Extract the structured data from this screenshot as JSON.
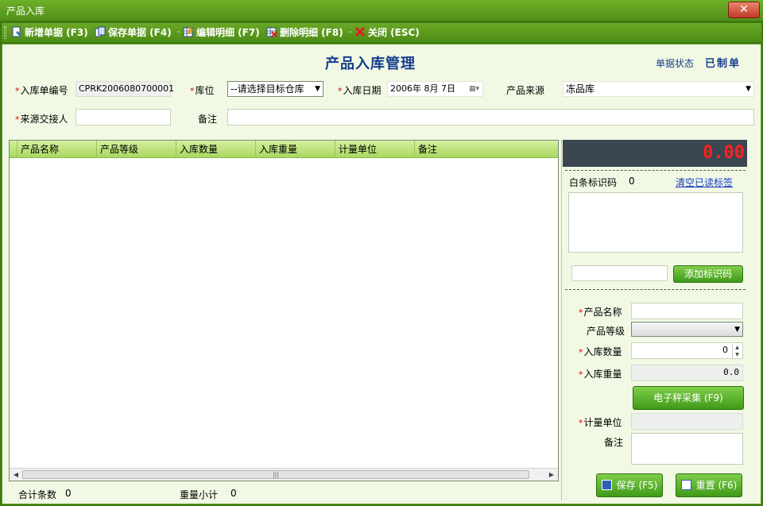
{
  "window": {
    "title": "产品入库",
    "close_label": "✕"
  },
  "toolbar": {
    "new_label": "新增单据 (F3)",
    "save_label": "保存单据 (F4)",
    "edit_label": "编辑明细 (F7)",
    "delete_label": "删除明细 (F8)",
    "close_label": "关闭 (ESC)",
    "separator": "-"
  },
  "header": {
    "title": "产品入库管理",
    "status_label": "单据状态",
    "status_value": "已制单"
  },
  "form": {
    "req_mark": "*",
    "order_no_label": "入库单编号",
    "order_no_value": "CPRK2006080700001",
    "location_label": "库位",
    "location_value": "--请选择目标仓库",
    "date_label": "入库日期",
    "date_value": "2006年 8月 7日",
    "source_label": "产品来源",
    "source_value": "冻品库",
    "handover_label": "来源交接人",
    "handover_value": "",
    "remark_label": "备注",
    "remark_value": ""
  },
  "grid": {
    "columns": [
      "产品名称",
      "产品等级",
      "入库数量",
      "入库重量",
      "计量单位",
      "备注"
    ],
    "rows": [],
    "scroll_grip": "|||"
  },
  "footer": {
    "total_count_label": "合计条数",
    "total_count_value": "0",
    "weight_subtotal_label": "重量小计",
    "weight_subtotal_value": "0"
  },
  "side": {
    "weight_display": "0.00",
    "barcode_label": "白条标识码",
    "barcode_count": "0",
    "clear_tags_label": "清空已读标签",
    "add_code_label": "添加标识码",
    "product_name_label": "产品名称",
    "product_grade_label": "产品等级",
    "in_qty_label": "入库数量",
    "in_qty_value": "0",
    "in_weight_label": "入库重量",
    "in_weight_value": "0.0",
    "scale_btn_label": "电子秤采集 (F9)",
    "unit_label": "计量单位",
    "remark_label": "备注",
    "save_btn_label": "保存 (F5)",
    "reset_btn_label": "重置 (F6)"
  }
}
